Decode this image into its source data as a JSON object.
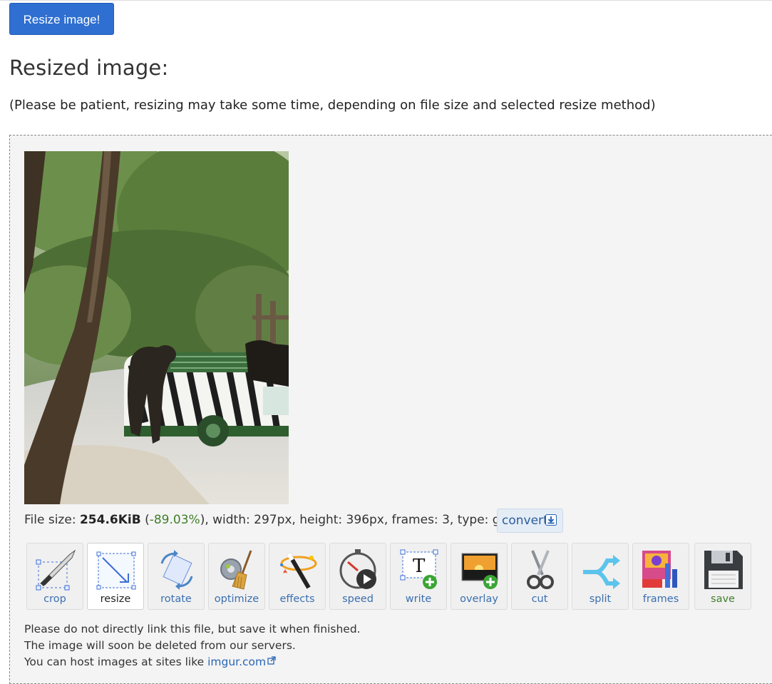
{
  "resize_button": "Resize image!",
  "heading": "Resized image:",
  "note": "(Please be patient, resizing may take some time, depending on file size and selected resize method)",
  "file_info": {
    "prefix": "File size: ",
    "size": "254.6KiB",
    "open": " (",
    "change": "-89.03%",
    "rest": "), width: 297px, height: 396px, frames: 3, type: gif"
  },
  "convert_label": "convert",
  "tools": [
    {
      "label": "crop",
      "icon": "crop-icon"
    },
    {
      "label": "resize",
      "icon": "resize-icon"
    },
    {
      "label": "rotate",
      "icon": "rotate-icon"
    },
    {
      "label": "optimize",
      "icon": "optimize-icon"
    },
    {
      "label": "effects",
      "icon": "effects-icon"
    },
    {
      "label": "speed",
      "icon": "speed-icon"
    },
    {
      "label": "write",
      "icon": "write-icon"
    },
    {
      "label": "overlay",
      "icon": "overlay-icon"
    },
    {
      "label": "cut",
      "icon": "cut-icon"
    },
    {
      "label": "split",
      "icon": "split-icon"
    },
    {
      "label": "frames",
      "icon": "frames-icon"
    },
    {
      "label": "save",
      "icon": "save-icon"
    }
  ],
  "footer": {
    "line1": "Please do not directly link this file, but save it when finished.",
    "line2": "The image will soon be deleted from our servers.",
    "line3_prefix": "You can host images at sites like ",
    "link": "imgur.com"
  },
  "colors": {
    "primary_button": "#2f6fd1",
    "success": "#3f7f2b",
    "link": "#2a64b4"
  }
}
